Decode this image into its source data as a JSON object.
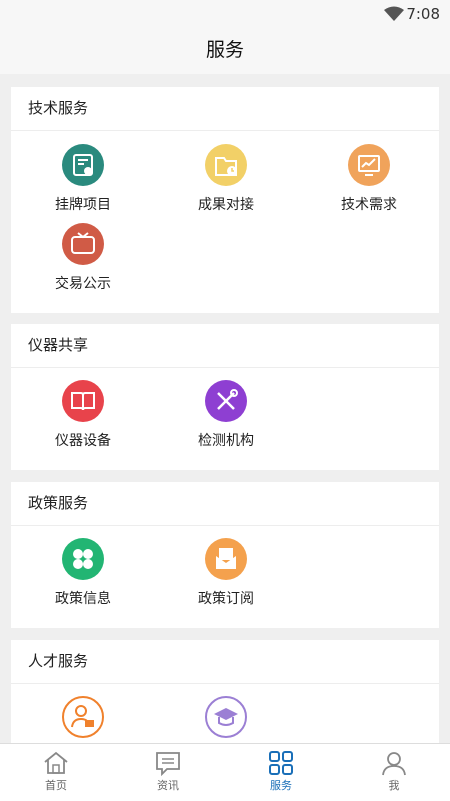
{
  "status": {
    "time": "7:08"
  },
  "header": {
    "title": "服务"
  },
  "sections": [
    {
      "title": "技术服务",
      "items": [
        {
          "label": "挂牌项目",
          "icon": "certificate-icon",
          "color": "#2a8a7e"
        },
        {
          "label": "成果对接",
          "icon": "folder-clock-icon",
          "color": "#f2d067"
        },
        {
          "label": "技术需求",
          "icon": "chart-monitor-icon",
          "color": "#f0a35b"
        },
        {
          "label": "交易公示",
          "icon": "tv-icon",
          "color": "#d05b46"
        }
      ]
    },
    {
      "title": "仪器共享",
      "items": [
        {
          "label": "仪器设备",
          "icon": "book-icon",
          "color": "#e8434b"
        },
        {
          "label": "检测机构",
          "icon": "tools-icon",
          "color": "#8e3fd2"
        }
      ]
    },
    {
      "title": "政策服务",
      "items": [
        {
          "label": "政策信息",
          "icon": "hexagons-icon",
          "color": "#22b573"
        },
        {
          "label": "政策订阅",
          "icon": "mail-doc-icon",
          "color": "#f4a14d"
        }
      ]
    },
    {
      "title": "人才服务",
      "items": [
        {
          "label": "",
          "icon": "person-card-icon",
          "color": "#f0812c"
        },
        {
          "label": "",
          "icon": "graduation-cap-icon",
          "color": "#9b7fd4"
        }
      ]
    }
  ],
  "tabs": [
    {
      "label": "首页",
      "icon": "home-icon",
      "active": false
    },
    {
      "label": "资讯",
      "icon": "news-icon",
      "active": false
    },
    {
      "label": "服务",
      "icon": "grid-icon",
      "active": true
    },
    {
      "label": "我",
      "icon": "user-icon",
      "active": false
    }
  ],
  "colors": {
    "accent": "#1a6fb8"
  }
}
